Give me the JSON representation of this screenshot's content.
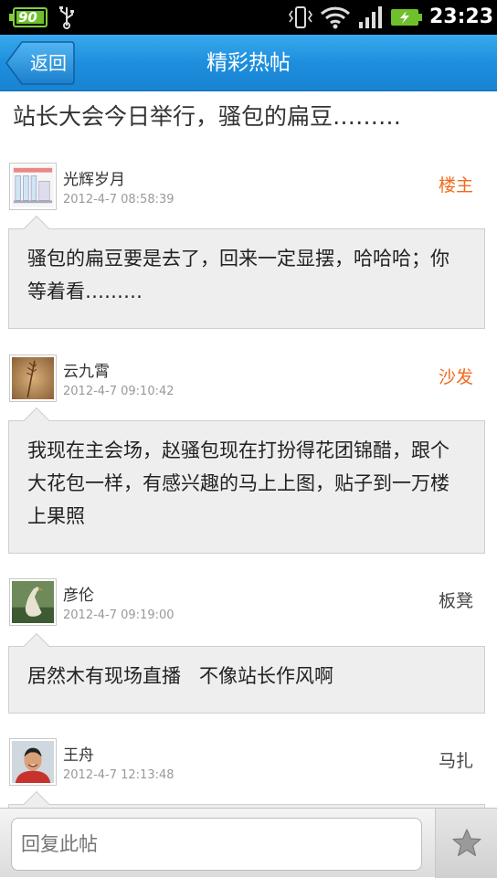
{
  "status_bar": {
    "battery_small_level": "90",
    "time": "23:23"
  },
  "header": {
    "back_label": "返回",
    "title": "精彩热帖"
  },
  "thread": {
    "title": "站长大会今日举行，骚包的扁豆………"
  },
  "posts": [
    {
      "author": "光辉岁月",
      "time": "2012-4-7 08:58:39",
      "floor": "楼主",
      "content": "骚包的扁豆要是去了，回来一定显摆，哈哈哈；你等着看………"
    },
    {
      "author": "云九霄",
      "time": "2012-4-7 09:10:42",
      "floor": "沙发",
      "content": "我现在主会场，赵骚包现在打扮得花团锦醋，跟个大花包一样，有感兴趣的马上上图，贴子到一万楼上果照"
    },
    {
      "author": "彦伦",
      "time": "2012-4-7 09:19:00",
      "floor": "板凳",
      "content": "居然木有现场直播   不像站长作风啊"
    },
    {
      "author": "王舟",
      "time": "2012-4-7 12:13:48",
      "floor": "马扎",
      "content": ""
    }
  ],
  "reply_bar": {
    "placeholder": "回复此帖",
    "favorite_icon": "star-icon"
  },
  "colors": {
    "header_blue": "#1e8fdd",
    "floor_highlight": "#f26a1b",
    "floor_normal": "#444444"
  }
}
